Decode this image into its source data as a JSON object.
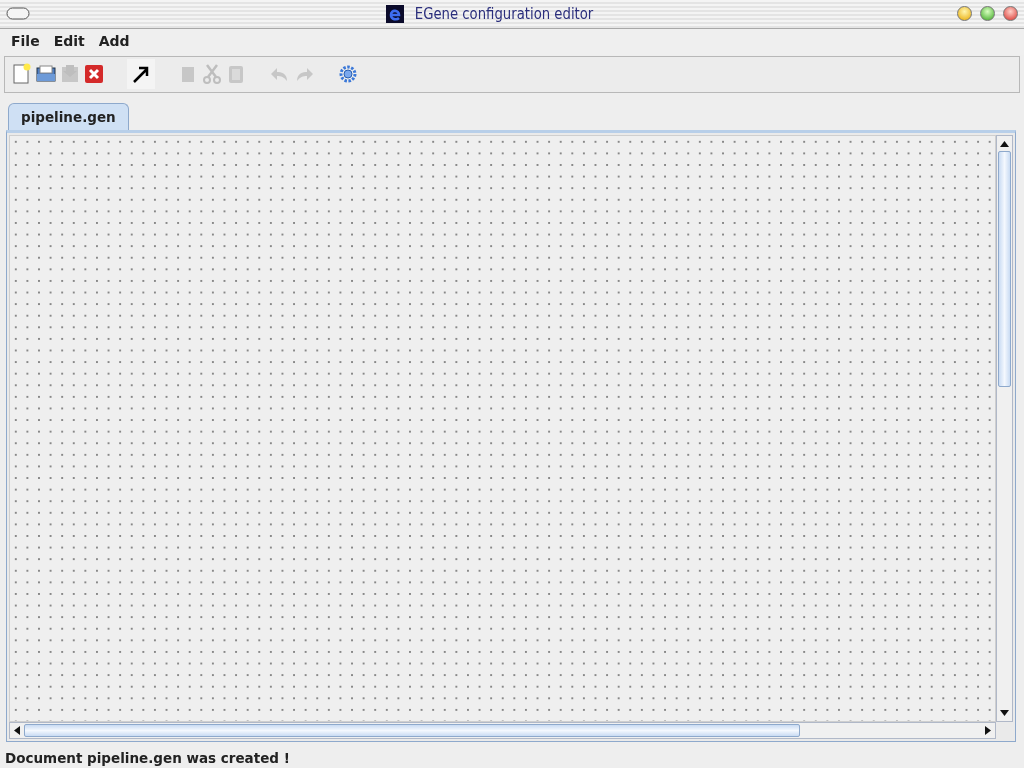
{
  "window": {
    "title": "EGene configuration editor"
  },
  "menu": [
    {
      "label": "File"
    },
    {
      "label": "Edit"
    },
    {
      "label": "Add"
    }
  ],
  "toolbar": [
    {
      "kind": "new",
      "disabled": false
    },
    {
      "kind": "open",
      "disabled": false
    },
    {
      "kind": "save",
      "disabled": true
    },
    {
      "kind": "close",
      "disabled": false
    },
    {
      "kind": "separator"
    },
    {
      "kind": "pointer",
      "disabled": false
    },
    {
      "kind": "separator"
    },
    {
      "kind": "copy",
      "disabled": true
    },
    {
      "kind": "cut",
      "disabled": true
    },
    {
      "kind": "paste",
      "disabled": true
    },
    {
      "kind": "separator"
    },
    {
      "kind": "undo",
      "disabled": true
    },
    {
      "kind": "redo",
      "disabled": true
    },
    {
      "kind": "separator"
    },
    {
      "kind": "settings",
      "disabled": false
    }
  ],
  "tabs": [
    {
      "label": "pipeline.gen",
      "selected": true
    }
  ],
  "status_bar": "Document pipeline.gen was created !"
}
